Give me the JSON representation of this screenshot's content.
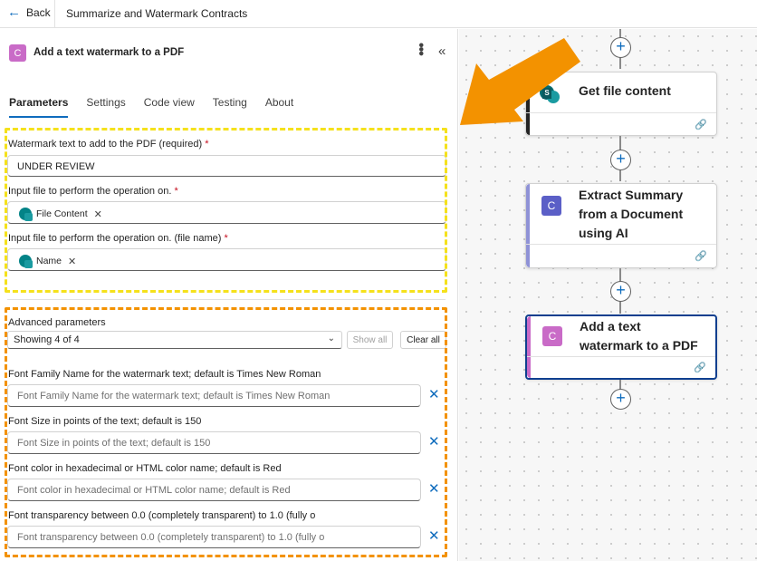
{
  "topbar": {
    "back_label": "Back",
    "flow_title": "Summarize and Watermark Contracts"
  },
  "panel": {
    "icon_letter": "C",
    "title": "Add a text watermark to a PDF",
    "tabs": [
      "Parameters",
      "Settings",
      "Code view",
      "Testing",
      "About"
    ],
    "active_tab": "Parameters",
    "fields": {
      "watermark_label": "Watermark text to add to the PDF (required)",
      "watermark_value": "UNDER REVIEW",
      "input_file_label": "Input file to perform the operation on.",
      "input_file_token": "File Content",
      "input_name_label": "Input file to perform the operation on. (file name)",
      "input_name_token": "Name",
      "required_mark": "*"
    },
    "advanced": {
      "label": "Advanced parameters",
      "select_value": "Showing 4 of 4",
      "show_all": "Show all",
      "clear_all": "Clear all",
      "params": [
        {
          "label": "Font Family Name for the watermark text; default is Times New Roman",
          "placeholder": "Font Family Name for the watermark text; default is Times New Roman"
        },
        {
          "label": "Font Size in points of the text; default is 150",
          "placeholder": "Font Size in points of the text; default is 150"
        },
        {
          "label": "Font color in hexadecimal or HTML color name; default is Red",
          "placeholder": "Font color in hexadecimal or HTML color name; default is Red"
        },
        {
          "label": "Font transparency between 0.0 (completely transparent) to 1.0 (fully o",
          "placeholder": "Font transparency between 0.0 (completely transparent) to 1.0 (fully o"
        }
      ]
    }
  },
  "canvas": {
    "cards": [
      {
        "title": "Get file content",
        "icon": "sharepoint-icon"
      },
      {
        "title_lines": [
          "Extract Summary",
          "from a Document",
          "using AI"
        ],
        "icon_letter": "C"
      },
      {
        "title_lines": [
          "Add a text",
          "watermark to a PDF"
        ],
        "icon_letter": "C"
      }
    ]
  },
  "colors": {
    "accent_blue": "#0f6cbd",
    "connector_purple": "#c96bc7",
    "ai_connector": "#5b5fc7",
    "sharepoint": "#038387",
    "highlight_yellow": "#f5e11c",
    "highlight_orange": "#f39200"
  }
}
